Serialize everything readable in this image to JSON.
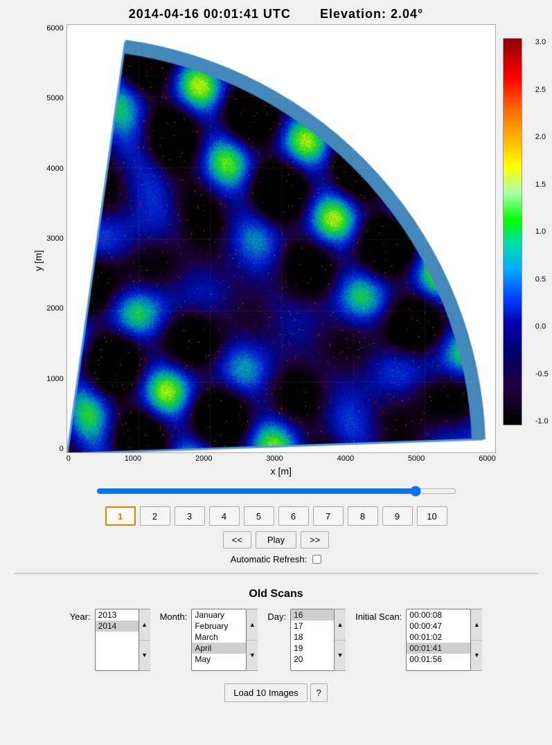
{
  "header": {
    "datetime": "2014-04-16 00:01:41 UTC",
    "elevation_label": "Elevation: 2.04°"
  },
  "plot": {
    "y_axis_title": "y [m]",
    "x_axis_title": "x [m]",
    "y_ticks": [
      "6000",
      "5000",
      "4000",
      "3000",
      "2000",
      "1000",
      "0"
    ],
    "x_ticks": [
      "0",
      "1000",
      "2000",
      "3000",
      "4000",
      "5000",
      "6000"
    ],
    "colorbar_ticks": [
      "3.0",
      "2.5",
      "2.0",
      "1.5",
      "1.0",
      "0.5",
      "0.0",
      "-0.5",
      "-1.0"
    ]
  },
  "controls": {
    "slider_value": 90,
    "frames": [
      "1",
      "2",
      "3",
      "4",
      "5",
      "6",
      "7",
      "8",
      "9",
      "10"
    ],
    "active_frame": "1",
    "nav_prev": "<<",
    "nav_play": "Play",
    "nav_next": ">>",
    "auto_refresh_label": "Automatic Refresh:"
  },
  "old_scans": {
    "title": "Old Scans",
    "year_label": "Year:",
    "years": [
      "2013",
      "2014"
    ],
    "selected_year": "2014",
    "month_label": "Month:",
    "months": [
      "January",
      "February",
      "March",
      "April",
      "May"
    ],
    "selected_month": "April",
    "day_label": "Day:",
    "days": [
      "16",
      "17",
      "18",
      "19",
      "20"
    ],
    "selected_day": "16",
    "initial_scan_label": "Initial Scan:",
    "scans": [
      "00:00:08",
      "00:00:47",
      "00:01:02",
      "00:01:41",
      "00:01:56"
    ],
    "selected_scan": "00:01:41",
    "load_button": "Load 10 Images",
    "help_button": "?"
  }
}
